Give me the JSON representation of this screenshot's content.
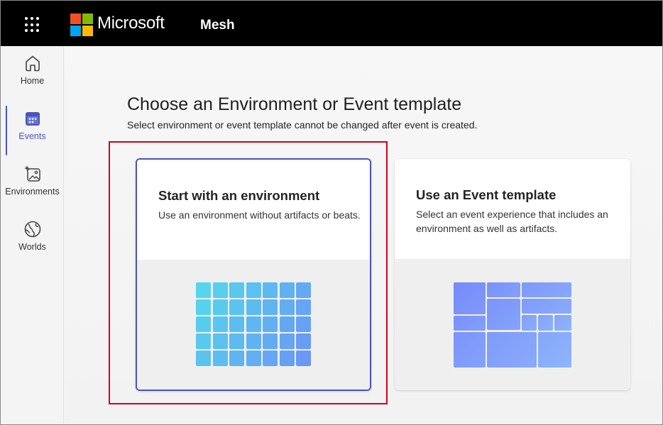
{
  "topbar": {
    "brand": "Microsoft",
    "app_name": "Mesh",
    "logo_colors": [
      "#f25022",
      "#7fba00",
      "#00a4ef",
      "#ffb900"
    ]
  },
  "rail": {
    "items": [
      {
        "label": "Home",
        "icon": "home-icon",
        "active": false
      },
      {
        "label": "Events",
        "icon": "calendar-icon",
        "active": true
      },
      {
        "label": "Environments",
        "icon": "image-sparkle-icon",
        "active": false
      },
      {
        "label": "Worlds",
        "icon": "globe-icon",
        "active": false
      }
    ],
    "accent": "#4b53bc"
  },
  "main": {
    "title": "Choose an Environment or Event template",
    "subtitle": "Select environment or event template cannot be changed after event is created.",
    "cards": [
      {
        "title": "Start with an environment",
        "description": "Use an environment without artifacts or beats.",
        "selected": true
      },
      {
        "title": "Use an Event template",
        "description": "Select an event experience that includes an environment as well as artifacts.",
        "selected": false
      }
    ]
  },
  "highlight_color": "#d0021b"
}
